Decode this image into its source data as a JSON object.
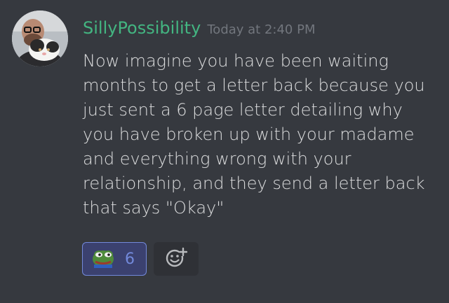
{
  "message": {
    "author": "SillyPossibility",
    "timestamp": "Today at 2:40 PM",
    "text": "Now imagine you have been waiting months to get a letter back because you just sent a 6 page letter detailing why you have broken up with your madame and everything wrong with your relationship, and they send a letter back that says \"Okay\"",
    "avatar_icon": "user-avatar-cat-photo"
  },
  "reactions": [
    {
      "emoji": "pepe-frog-emoji",
      "count": "6",
      "active": true
    }
  ],
  "add_reaction": {
    "icon": "add-reaction-smiley-icon"
  },
  "colors": {
    "background": "#36393f",
    "username": "#43b581",
    "timestamp": "#72767d",
    "text": "#dcddde",
    "reaction_active_bg": "#3b416f",
    "reaction_active_border": "#7289da"
  }
}
